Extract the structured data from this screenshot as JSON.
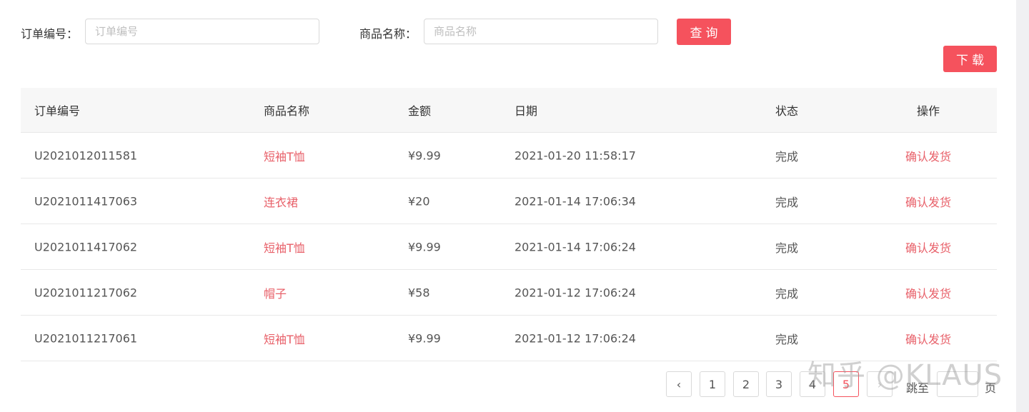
{
  "search": {
    "order_label": "订单编号：",
    "order_placeholder": "订单编号",
    "order_value": "",
    "product_label": "商品名称：",
    "product_placeholder": "商品名称",
    "product_value": "",
    "query_button": "查询"
  },
  "download_button": "下载",
  "table": {
    "headers": [
      "订单编号",
      "商品名称",
      "金额",
      "日期",
      "状态",
      "操作"
    ],
    "rows": [
      {
        "order": "U2021012011581",
        "product": "短袖T恤",
        "amount": "¥9.99",
        "date": "2021-01-20 11:58:17",
        "status": "完成",
        "action": "确认发货"
      },
      {
        "order": "U2021011417063",
        "product": "连衣裙",
        "amount": "¥20",
        "date": "2021-01-14 17:06:34",
        "status": "完成",
        "action": "确认发货"
      },
      {
        "order": "U2021011417062",
        "product": "短袖T恤",
        "amount": "¥9.99",
        "date": "2021-01-14 17:06:24",
        "status": "完成",
        "action": "确认发货"
      },
      {
        "order": "U2021011217062",
        "product": "帽子",
        "amount": "¥58",
        "date": "2021-01-12 17:06:24",
        "status": "完成",
        "action": "确认发货"
      },
      {
        "order": "U2021011217061",
        "product": "短袖T恤",
        "amount": "¥9.99",
        "date": "2021-01-12 17:06:24",
        "status": "完成",
        "action": "确认发货"
      }
    ]
  },
  "pagination": {
    "prev_icon": "‹",
    "next_icon": "›",
    "pages": [
      "1",
      "2",
      "3",
      "4",
      "5"
    ],
    "current_page": "5",
    "jump_label": "跳至",
    "jump_suffix": "页",
    "jump_value": ""
  },
  "watermark": "知乎 @KLAUS",
  "colors": {
    "accent": "#f5525d",
    "link": "#e8616a",
    "header_bg": "#f7f7f7"
  }
}
